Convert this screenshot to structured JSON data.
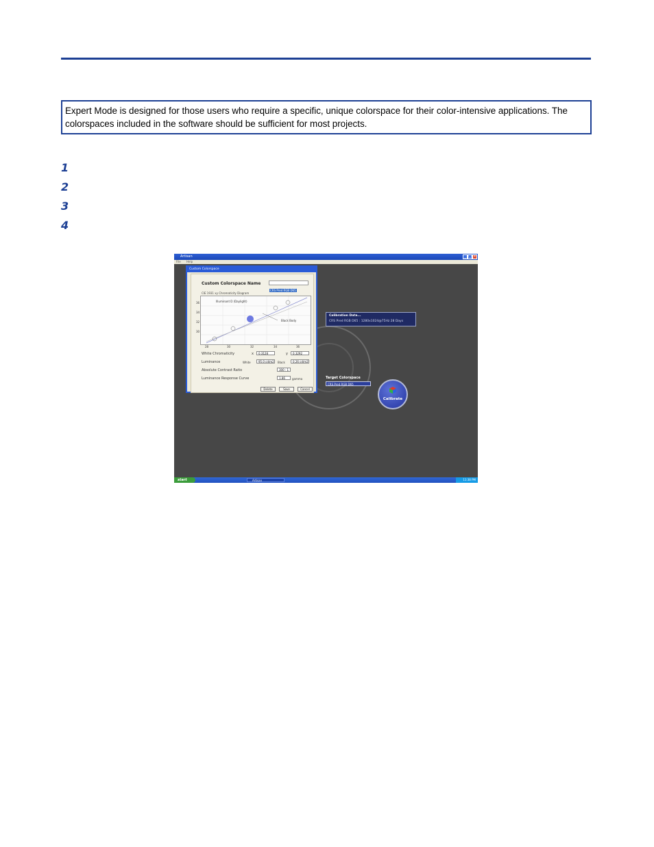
{
  "note": {
    "text": "Expert Mode is designed for those users who require a specific, unique colorspace for their color-intensive applications. The colorspaces included in the software should be sufficient for most projects."
  },
  "steps": [
    "1",
    "2",
    "3",
    "4"
  ],
  "screenshot": {
    "window_title": "Artisan",
    "menu": [
      "File",
      "Help"
    ],
    "dialog": {
      "title": "Custom Colorspace",
      "name_label": "Custom Colorspace Name",
      "name_value": "CRS Pred RGB D65",
      "chart_caption": "CIE 1931 xy Chromaticity Diagram",
      "illuminant_label": "Illuminant D (Daylight)",
      "blackbody_label": "Black Body",
      "y_ticks": [
        "36",
        "34",
        "32",
        "30"
      ],
      "x_ticks": [
        "28",
        "30",
        "32",
        "34",
        "36"
      ],
      "white_chromaticity_label": "White Chromaticity",
      "x_label": "x",
      "x_value": "0.3128",
      "y_label": "y",
      "y_value": "0.3292",
      "luminance_label": "Luminance",
      "white_label": "White",
      "white_value": "95.0 cd/m2",
      "black_label": "Black",
      "black_value": "0.26 cd/m2",
      "contrast_label": "Absolute Contrast Ratio",
      "contrast_value": "300 : 1",
      "curve_label": "Luminance Response Curve",
      "curve_value": "1.86",
      "gamma_label": "gamma",
      "buttons": [
        "Delete",
        "Save",
        "Cancel"
      ]
    },
    "calibration_panel": {
      "heading": "Calibration Data...",
      "value": "CRS Pred RGB D65 :  1280x1024@75Hz    28 Days"
    },
    "target_colorspace_label": "Target Colorspace",
    "target_colorspace_value": "CRS Pred RGB D65",
    "calibrate_label": "Calibrate",
    "taskbar": {
      "start": "start",
      "task": "Artisan",
      "clock": "11:38 PM"
    }
  },
  "colors": {
    "accent": "#1c3f94",
    "screen_bg": "#474747",
    "xp_blue": "#2a5bd7"
  }
}
